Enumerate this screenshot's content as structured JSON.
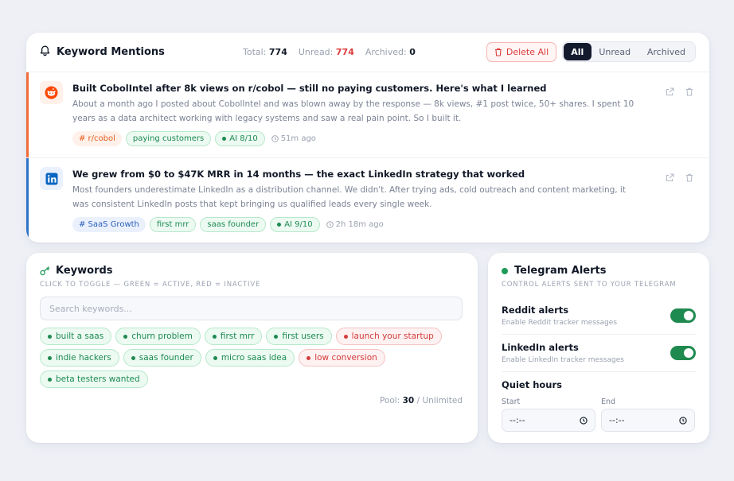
{
  "mentions_panel": {
    "title": "Keyword Mentions",
    "stats": {
      "total_label": "Total:",
      "total_value": "774",
      "unread_label": "Unread:",
      "unread_value": "774",
      "archived_label": "Archived:",
      "archived_value": "0"
    },
    "delete_all_label": "Delete All",
    "filter_tabs": [
      "All",
      "Unread",
      "Archived"
    ],
    "active_filter": "All",
    "items": [
      {
        "source": "reddit",
        "accent_color": "#f26b3a",
        "headline": "Built CobolIntel after 8k views on r/cobol — still no paying customers. Here's what I learned",
        "excerpt": "About a month ago I posted about CobolIntel and was blown away by the response — 8k views, #1 post twice, 50+ shares. I spent 10 years as a data architect working with legacy systems and saw a real pain point. So I built it.",
        "subreddit": "# r/cobol",
        "keywords": [
          "paying customers"
        ],
        "ai_score": "AI 8/10",
        "time": "51m ago"
      },
      {
        "source": "linkedin",
        "accent_color": "#2f73c9",
        "headline": "We grew from $0 to $47K MRR in 14 months — the exact LinkedIn strategy that worked",
        "excerpt": "Most founders underestimate LinkedIn as a distribution channel. We didn't. After trying ads, cold outreach and content marketing, it was consistent LinkedIn posts that kept bringing us qualified leads every single week.",
        "subreddit": "# SaaS Growth",
        "keywords": [
          "first mrr",
          "saas founder"
        ],
        "ai_score": "AI 9/10",
        "time": "2h 18m ago"
      }
    ]
  },
  "keywords_panel": {
    "title": "Keywords",
    "subtitle": "CLICK TO TOGGLE — GREEN = ACTIVE, RED = INACTIVE",
    "search_placeholder": "Search keywords...",
    "keywords": [
      {
        "label": "built a saas",
        "active": true
      },
      {
        "label": "churn problem",
        "active": true
      },
      {
        "label": "first mrr",
        "active": true
      },
      {
        "label": "first users",
        "active": true
      },
      {
        "label": "launch your startup",
        "active": false
      },
      {
        "label": "indie hackers",
        "active": true
      },
      {
        "label": "saas founder",
        "active": true
      },
      {
        "label": "micro saas idea",
        "active": true
      },
      {
        "label": "low conversion",
        "active": false
      },
      {
        "label": "beta testers wanted",
        "active": true
      }
    ],
    "pool_label": "Pool:",
    "pool_count": "30",
    "pool_limit": "/ Unlimited"
  },
  "telegram_panel": {
    "title": "Telegram Alerts",
    "subtitle": "CONTROL ALERTS SENT TO YOUR TELEGRAM",
    "reddit_alerts": {
      "label": "Reddit alerts",
      "description": "Enable Reddit tracker messages",
      "enabled": true
    },
    "linkedin_alerts": {
      "label": "LinkedIn alerts",
      "description": "Enable LinkedIn tracker messages",
      "enabled": true
    },
    "quiet_hours": {
      "title": "Quiet hours",
      "start_label": "Start",
      "start_value": "--:--",
      "end_label": "End",
      "end_value": "--:--"
    }
  },
  "colors": {
    "active_green": "#1e8a51",
    "inactive_red": "#d43c3c",
    "dark_tab": "#141a2e",
    "reddit_orange": "#f26b3a",
    "linkedin_blue": "#2f73c9"
  },
  "icons": [
    "bell-icon",
    "trash-icon",
    "reddit-icon",
    "linkedin-icon",
    "external-link-icon",
    "clock-icon",
    "key-icon"
  ]
}
